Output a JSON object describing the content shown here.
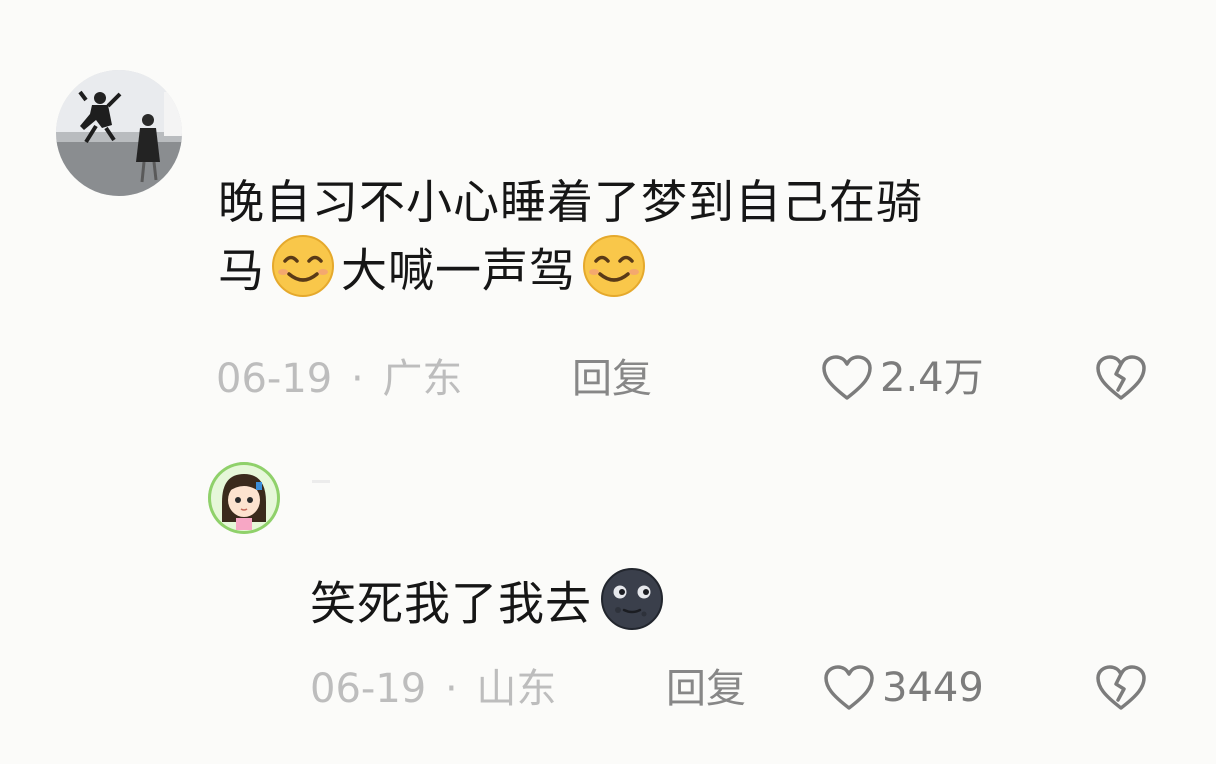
{
  "comments": [
    {
      "text_line1": "晚自习不小心睡着了梦到自己在骑",
      "text_line2a": "马",
      "text_line2b": "大喊一声驾",
      "date": "06-19",
      "separator": "·",
      "location": "广东",
      "reply_label": "回复",
      "likes": "2.4万"
    },
    {
      "text": "笑死我了我去",
      "date": "06-19",
      "separator": "·",
      "location": "山东",
      "reply_label": "回复",
      "likes": "3449"
    }
  ],
  "icons": {
    "like": "heart-outline-icon",
    "dislike": "broken-heart-icon",
    "emoji_smile": "smiling-face-emoji",
    "emoji_moon": "new-moon-face-emoji"
  },
  "colors": {
    "background": "#fbfbf9",
    "text": "#161616",
    "meta": "#bdbdbd",
    "action": "#878787"
  }
}
